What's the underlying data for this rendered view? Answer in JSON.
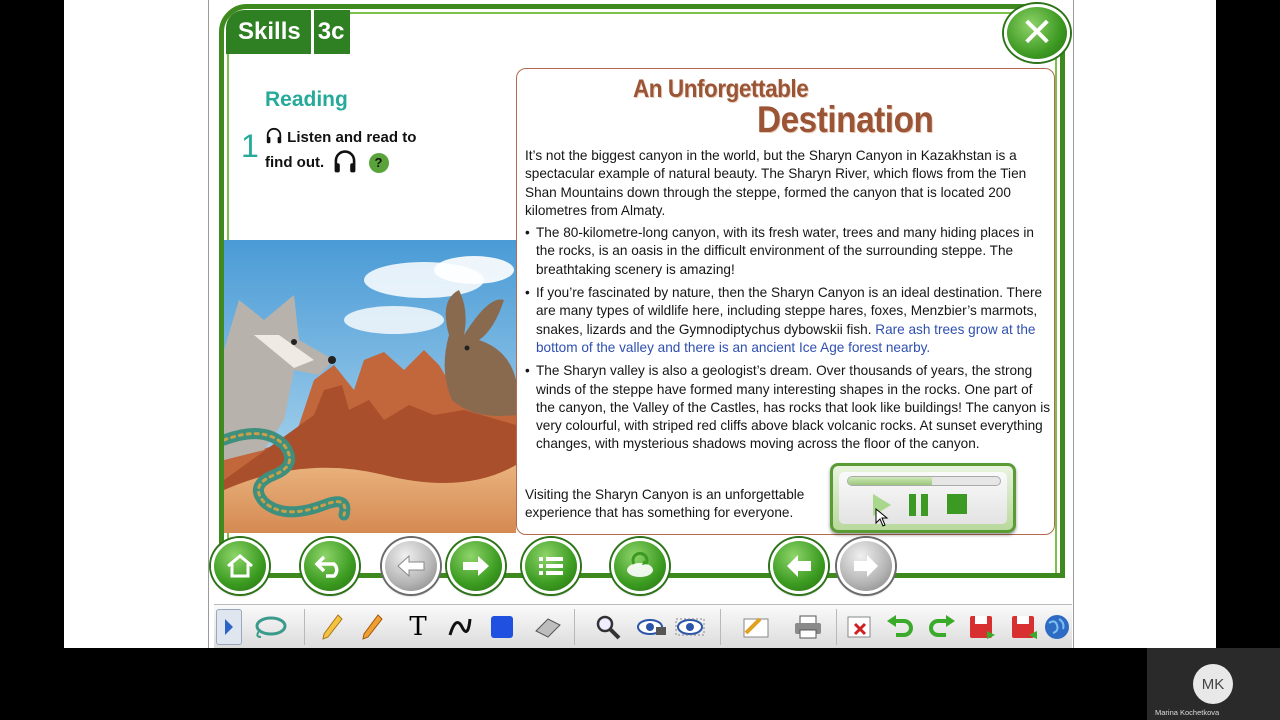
{
  "header": {
    "skills_label": "Skills",
    "unit_label": "3c"
  },
  "section": {
    "title": "Reading",
    "exercise_number": "1",
    "instruction_line1": "Listen and read to",
    "instruction_line2": "find out.",
    "help_label": "?"
  },
  "article": {
    "title_line1": "An Unforgettable",
    "title_line2": "Destination",
    "intro": "It’s not the biggest canyon in the world, but the Sharyn Canyon in Kazakhstan is a spectacular example of natural beauty. The Sharyn River, which flows from the Tien Shan Mountains down through the steppe, formed the canyon that is located 200 kilometres from Almaty.",
    "bullet1": "The 80-kilometre-long canyon, with its fresh water, trees and many hiding places in the rocks, is an oasis in the difficult environment of the surrounding steppe. The breathtaking scenery is amazing!",
    "bullet2_plain": "If you’re fascinated by nature, then the Sharyn Canyon is an ideal destination. There are many types of wildlife here, including steppe hares, foxes, Menzbier’s marmots, snakes, lizards and the Gymnodiptychus dybowskii fish. ",
    "bullet2_highlight": "Rare ash trees grow at the bottom of the valley and there is an ancient Ice Age forest nearby.",
    "bullet3": "The Sharyn valley is also a geologist’s dream. Over thousands of years, the strong winds of the steppe have formed many interesting shapes in the rocks. One part of the canyon, the Valley of the Castles, has rocks that look like buildings! The canyon is very colourful, with striped red cliffs above black volcanic rocks. At sunset everything changes, with mysterious shadows moving across the floor of the canyon.",
    "closing": "Visiting the Sharyn Canyon is an unforgettable experience that has something for everyone.",
    "highlight_color": "#2e4fb0"
  },
  "audio_player": {
    "progress": 0.55
  },
  "nav_icons": [
    "home-icon",
    "back-icon",
    "arrow-left-icon",
    "arrow-right-icon",
    "list-icon",
    "refresh-icon",
    "prev-page-icon",
    "next-page-icon"
  ],
  "participant": {
    "initials": "MK",
    "name": "Marina Kochetkova"
  },
  "colors": {
    "frame_green": "#3e8a1e",
    "teal": "#26aa9a",
    "title_brown": "#9a5436"
  }
}
